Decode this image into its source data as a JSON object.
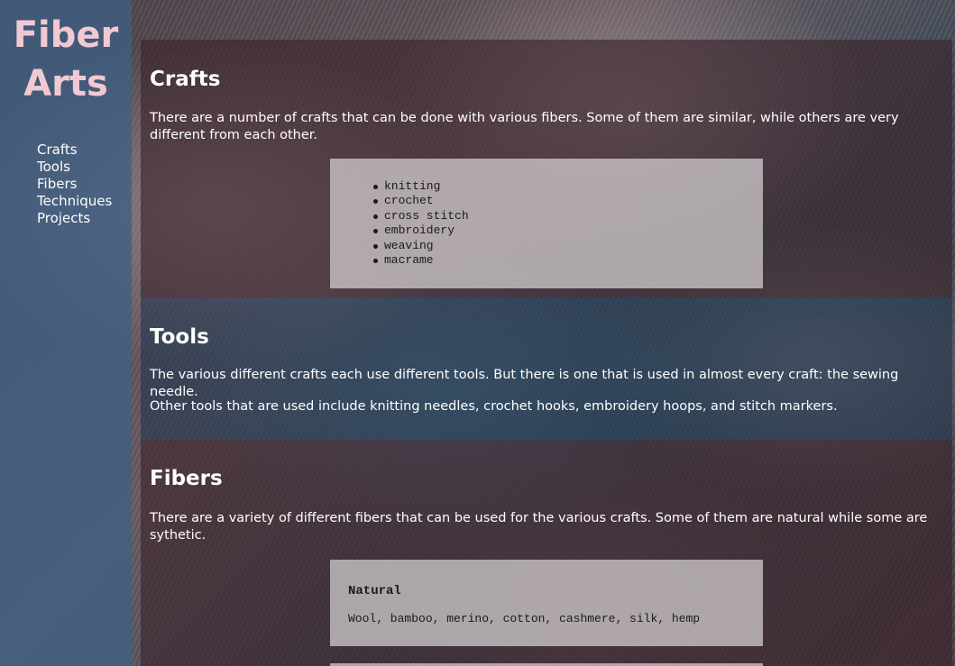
{
  "site": {
    "title_line1": "Fiber",
    "title_line2": "Arts"
  },
  "nav": {
    "items": [
      {
        "label": "Crafts"
      },
      {
        "label": "Tools"
      },
      {
        "label": "Fibers"
      },
      {
        "label": "Techniques"
      },
      {
        "label": "Projects"
      }
    ]
  },
  "crafts": {
    "heading": "Crafts",
    "intro": "There are a number of crafts that can be done with various fibers. Some of them are similar, while others are very different from each other.",
    "list": [
      "knitting",
      "crochet",
      "cross stitch",
      "embroidery",
      "weaving",
      "macrame"
    ]
  },
  "tools": {
    "heading": "Tools",
    "paragraph1": "The various different crafts each use different tools. But there is one that is used in almost every craft: the sewing needle.",
    "paragraph2": "Other tools that are used include knitting needles, crochet hooks, embroidery hoops, and stitch markers."
  },
  "fibers": {
    "heading": "Fibers",
    "intro": "There are a variety of different fibers that can be used for the various crafts. Some of them are natural while some are sythetic.",
    "natural_heading": "Natural",
    "natural_values": "Wool, bamboo, merino, cotton, cashmere, silk, hemp"
  },
  "colors": {
    "title_pink": "#f2c9d3",
    "sidebar_blue": "#3e6084",
    "section_plum": "#3a222a",
    "section_navy": "#1c344e"
  }
}
